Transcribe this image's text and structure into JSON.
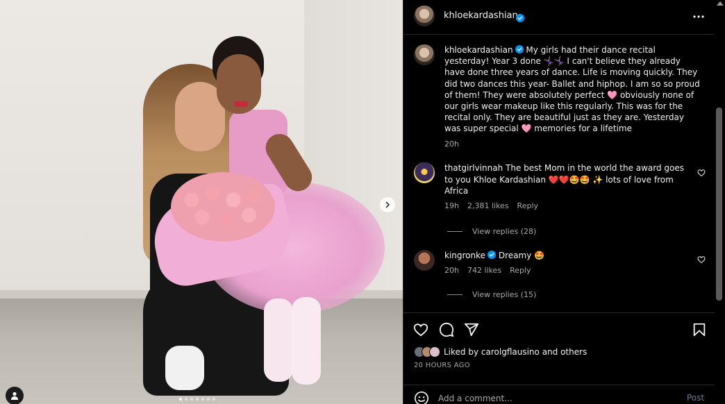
{
  "photo": {
    "carousel_dots": 7,
    "active_dot": 0,
    "next_icon": "chevron-right-icon",
    "tag_icon": "user-tag-icon"
  },
  "header": {
    "username": "khloekardashian",
    "verified": true,
    "more_icon": "more-horizontal-icon"
  },
  "caption": {
    "username": "khloekardashian",
    "text": "My girls had their dance recital yesterday! Year 3 done 🤸🏽‍♀️🤸🏽‍♀️ I can't believe they already have done three years of dance. Life is moving quickly. They did two dances this year- Ballet and hiphop. I am so so proud of them! They were absolutely perfect 🩷 obviously none of our girls wear makeup like this regularly. This was for the recital only. They are beautiful just as they are. Yesterday was super special 🩷 memories for a lifetime",
    "time": "20h"
  },
  "comments": [
    {
      "username": "thatgirlvinnah",
      "verified": false,
      "text": "The best Mom in the world the award goes to you Khloe Kardashian ❤️❤️🤩🤩 ✨ lots of love from Africa",
      "time": "19h",
      "likes": "2,381 likes",
      "reply_label": "Reply",
      "view_replies": "View replies (28)"
    },
    {
      "username": "kingronke",
      "verified": true,
      "text": "Dreamy 🤩",
      "time": "20h",
      "likes": "742 likes",
      "reply_label": "Reply",
      "view_replies": "View replies (15)"
    }
  ],
  "actions": {
    "like_icon": "heart-icon",
    "comment_icon": "comment-icon",
    "share_icon": "share-icon",
    "save_icon": "bookmark-icon",
    "liked_by_prefix": "Liked by",
    "liked_by_user": "carolgflausino",
    "liked_by_suffix": "and others",
    "post_time": "20 HOURS AGO"
  },
  "comment_bar": {
    "emoji_icon": "emoji-icon",
    "placeholder": "Add a comment...",
    "post_label": "Post"
  },
  "colors": {
    "background": "#000000",
    "text": "#f5f5f5",
    "secondary_text": "#a8a8a8",
    "verified_blue": "#0095f6",
    "like_red": "#ff3040",
    "post_disabled": "#6b7d96"
  }
}
